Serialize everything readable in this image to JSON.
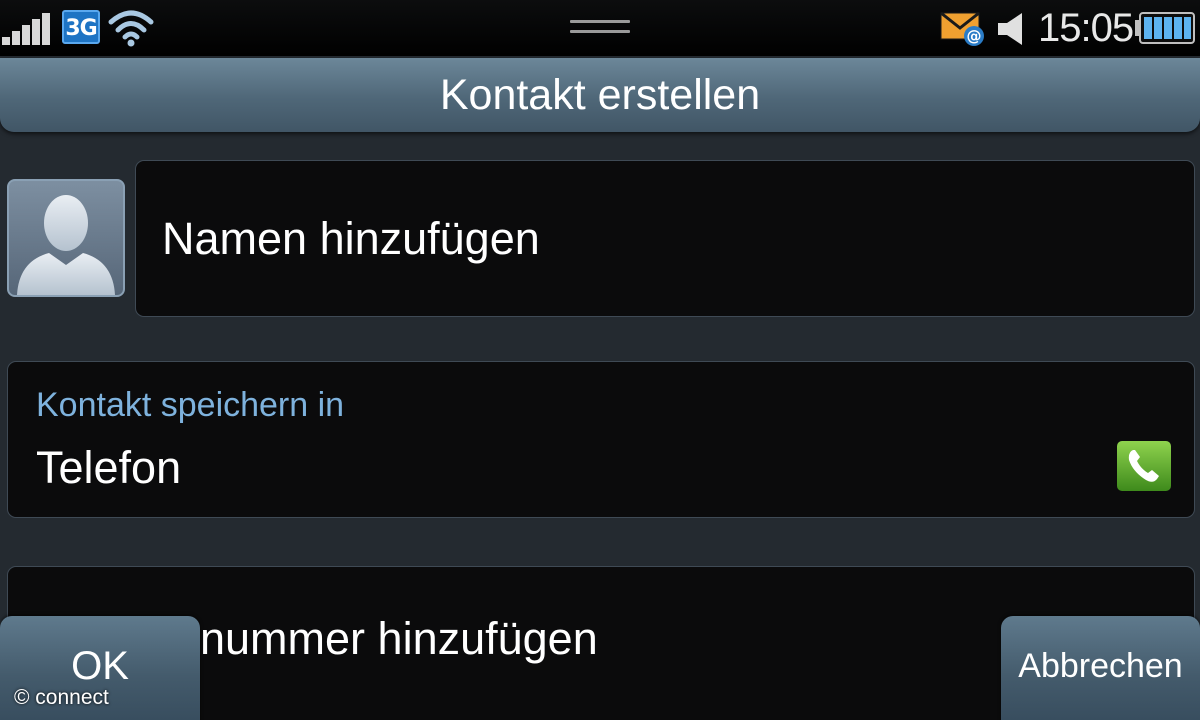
{
  "statusbar": {
    "network": "3G",
    "time": "15:05",
    "icons": [
      "signal-strength-icon",
      "3g-icon",
      "wifi-icon",
      "notification-handle",
      "email-icon",
      "speaker-icon",
      "battery-icon"
    ]
  },
  "header": {
    "title": "Kontakt erstellen"
  },
  "form": {
    "name_placeholder": "Namen hinzufügen",
    "save_in_caption": "Kontakt speichern in",
    "save_in_value": "Telefon",
    "number_placeholder": "Telefonnummer hinzufügen",
    "number_visible_text": "nummer hinzufügen"
  },
  "softkeys": {
    "ok": "OK",
    "cancel": "Abbrechen"
  },
  "watermark": "© connect",
  "colors": {
    "titlebar": "#4f6778",
    "caption_blue": "#7eb2dd",
    "field_bg": "#0b0b0c",
    "phone_green": "#5cae2a",
    "mail_orange": "#f0a030"
  }
}
